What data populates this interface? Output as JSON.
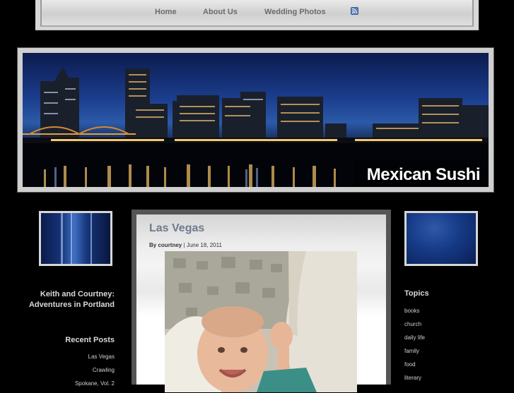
{
  "nav": {
    "items": [
      {
        "label": "Home"
      },
      {
        "label": "About Us"
      },
      {
        "label": "Wedding Photos"
      }
    ],
    "rss_icon": "rss-feed-icon"
  },
  "banner": {
    "site_title": "Mexican Sushi"
  },
  "sidebar_left": {
    "blog_title": "Keith and Courtney: Adventures in Portland",
    "recent_posts_heading": "Recent Posts",
    "recent_posts": [
      "Las Vegas",
      "Crawling",
      "Spokane, Vol. 2"
    ]
  },
  "post": {
    "title": "Las Vegas",
    "byline_prefix": "By",
    "author": "courtney",
    "separator": "|",
    "date": "June 18, 2011"
  },
  "sidebar_right": {
    "topics_heading": "Topics",
    "topics": [
      "books",
      "church",
      "daily life",
      "family",
      "food",
      "literary"
    ]
  },
  "colors": {
    "nav_text": "#6b6b6b",
    "post_title": "#6d7b8f",
    "sidebar_text": "#d9d9d9",
    "background": "#000000"
  }
}
